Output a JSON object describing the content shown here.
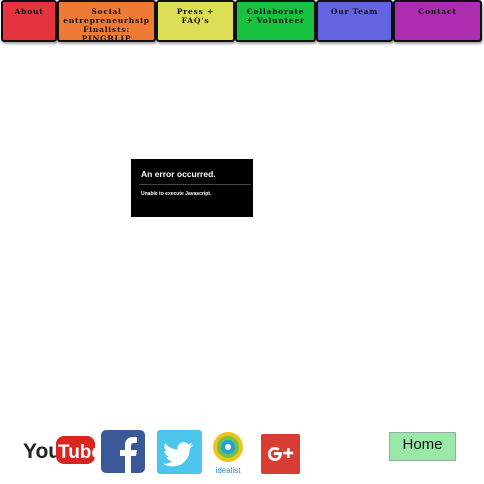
{
  "nav": {
    "items": [
      {
        "label": "About",
        "color": "#e53440"
      },
      {
        "label": "Social\nentrepreneurhsip\nFinalists: PINGBLIP",
        "color": "#ef7a35"
      },
      {
        "label": "Press +\nFAQ's",
        "color": "#dcdf55"
      },
      {
        "label": "Collaborate\n+ Volunteer",
        "color": "#17c240"
      },
      {
        "label": "Our Team",
        "color": "#6463e0"
      },
      {
        "label": "Contact",
        "color": "#ad2db1"
      }
    ]
  },
  "embed_error": {
    "title": "An error occurred.",
    "message": "Unable to execute Javascript."
  },
  "social": {
    "youtube": {
      "text_you": "You",
      "text_tube": "Tube",
      "icon": "youtube-icon"
    },
    "facebook": {
      "icon": "facebook-icon"
    },
    "twitter": {
      "icon": "twitter-icon"
    },
    "idealist": {
      "label": "idealist",
      "icon": "idealist-icon"
    },
    "gplus": {
      "icon": "google-plus-icon"
    }
  },
  "home_button": {
    "label": "Home"
  }
}
